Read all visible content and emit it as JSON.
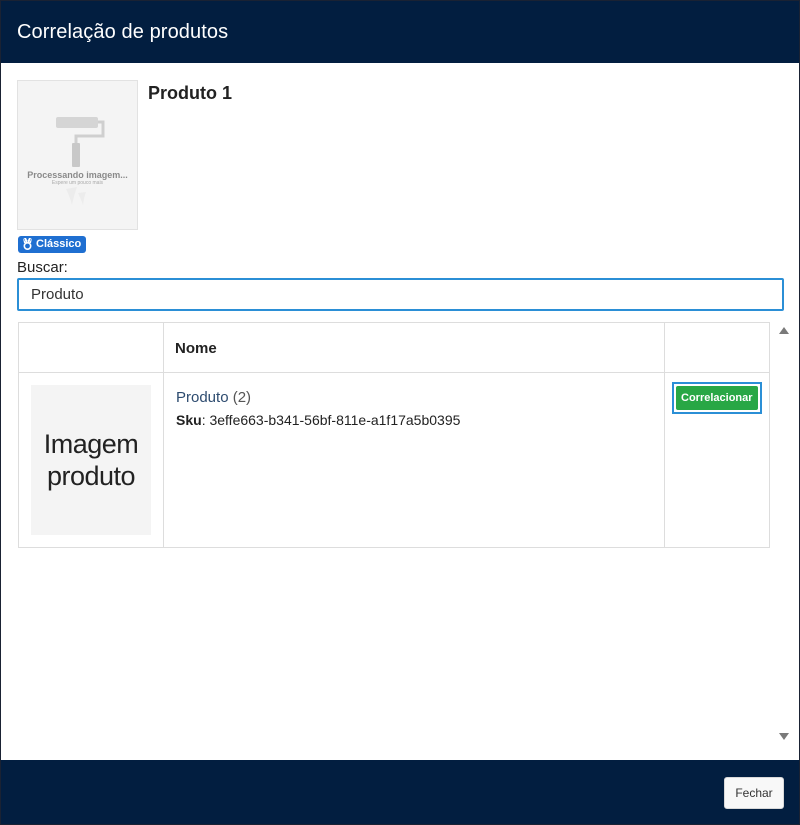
{
  "modal": {
    "title": "Correlação de produtos"
  },
  "product": {
    "name": "Produto 1",
    "thumbnail_text": "Processando imagem...",
    "thumbnail_subtext": "Espere um pouco mais",
    "badge_label": "Clássico",
    "badge_icon": "medal-icon"
  },
  "search": {
    "label": "Buscar:",
    "value": "Produto"
  },
  "table": {
    "headers": [
      "",
      "Nome",
      ""
    ],
    "rows": [
      {
        "image_text_line1": "Imagem",
        "image_text_line2": "produto",
        "name": "Produto",
        "count": "(2)",
        "sku_label": "Sku",
        "sku_value": ": 3effe663-b341-56bf-811e-a1f17a5b0395",
        "action_label": "Correlacionar"
      }
    ]
  },
  "footer": {
    "close_label": "Fechar"
  },
  "colors": {
    "header_bg": "#021e40",
    "badge_bg": "#1f6fd1",
    "action_green": "#28a745",
    "focus_blue": "#2b8fd6"
  }
}
